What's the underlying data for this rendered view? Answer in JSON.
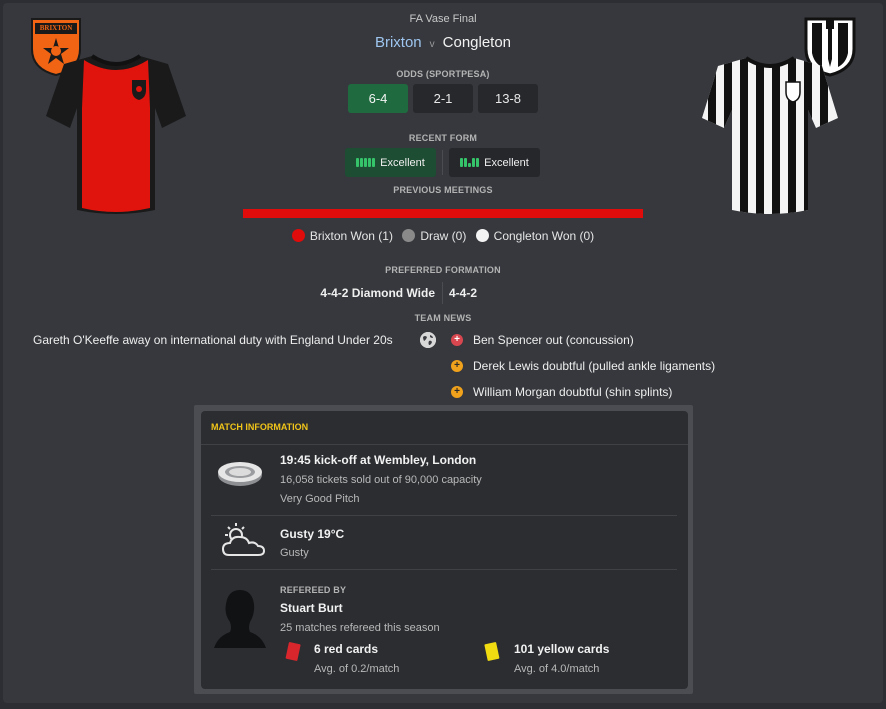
{
  "header": {
    "competition": "FA Vase Final",
    "home_team": "Brixton",
    "versus": "v",
    "away_team": "Congleton",
    "home_crest_text": "BRIXTON"
  },
  "odds": {
    "label": "ODDS (SPORTPESA)",
    "values": [
      "6-4",
      "2-1",
      "13-8"
    ]
  },
  "recent_form": {
    "label": "RECENT FORM",
    "home": "Excellent",
    "away": "Excellent"
  },
  "previous_meetings": {
    "label": "PREVIOUS MEETINGS",
    "home_won": "Brixton Won (1)",
    "draw": "Draw (0)",
    "away_won": "Congleton Won (0)",
    "home_fraction": 1.0
  },
  "formation": {
    "label": "PREFERRED FORMATION",
    "home": "4-4-2 Diamond Wide",
    "away": "4-4-2"
  },
  "team_news": {
    "label": "TEAM NEWS",
    "home": [
      "Gareth O'Keeffe away on international duty with England Under 20s"
    ],
    "away": [
      {
        "text": "Ben Spencer out (concussion)",
        "status": "out"
      },
      {
        "text": "Derek Lewis doubtful (pulled ankle ligaments)",
        "status": "doubtful"
      },
      {
        "text": "William Morgan doubtful (shin splints)",
        "status": "doubtful"
      }
    ]
  },
  "match_info": {
    "title": "MATCH INFORMATION",
    "venue": {
      "headline": "19:45 kick-off at Wembley, London",
      "tickets": "16,058 tickets sold out of 90,000 capacity",
      "pitch": "Very Good Pitch"
    },
    "weather": {
      "headline": "Gusty 19°C",
      "detail": "Gusty"
    },
    "referee": {
      "label": "REFEREED BY",
      "name": "Stuart Burt",
      "matches": "25 matches refereed this season",
      "red_cards": "6 red cards",
      "red_avg": "Avg. of 0.2/match",
      "yellow_cards": "101 yellow cards",
      "yellow_avg": "Avg. of 4.0/match"
    }
  },
  "colors": {
    "home_kit": "#e0140c",
    "away_kit_stripe": "#111111",
    "selected_odds": "#1f6b3f",
    "meetings_bar": "#e00b0b",
    "accent_title": "#f0c419"
  }
}
